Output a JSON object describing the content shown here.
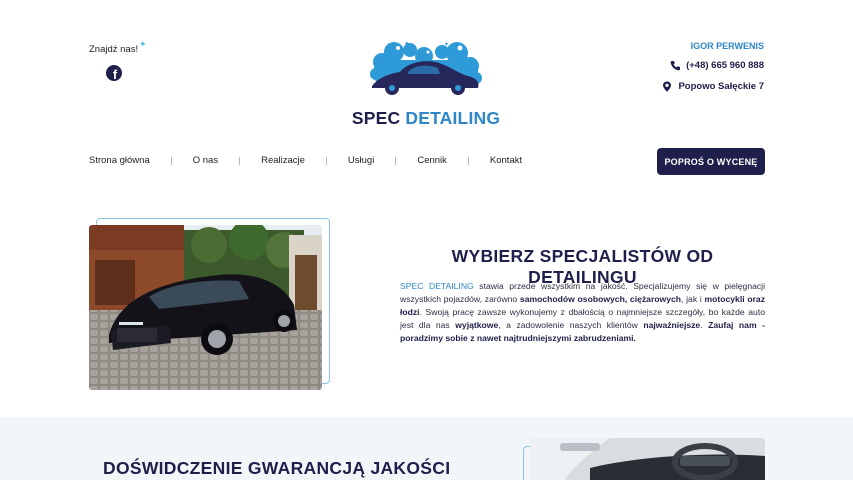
{
  "header": {
    "find_us": "Znajdź nas!",
    "brand_part1": "SPEC",
    "brand_part2": "DETAILING",
    "contact_name": "IGOR PERWENIS",
    "phone": "(+48) 665 960 888",
    "address": "Popowo Sałęckie 7"
  },
  "nav": {
    "items": [
      "Strona główna",
      "O nas",
      "Realizacje",
      "Usługi",
      "Cennik",
      "Kontakt"
    ],
    "cta": "POPROŚ O WYCENĘ"
  },
  "hero": {
    "title": "WYBIERZ SPECJALISTÓW OD DETAILINGU",
    "p_brand1": "SPEC",
    "p_brand2": "DETAILING",
    "p1": " stawia przede wszystkim na jakość. Specjalizujemy się w pielęgnacji wszystkich pojazdów, zarówno ",
    "b1": "samochodów osobowych, ciężarowych",
    "p2": ", jak i ",
    "b2": "motocykli oraz łodzi",
    "p3": ". Swoją pracę zawsze wykonujemy z dbałością o najmniejsze szczegóły, bo każde auto jest dla nas ",
    "b3": "wyjątkowe",
    "p4": ", a zadowolenie naszych klientów ",
    "b4": "najważniejsze",
    "p5": ". ",
    "b5": "Zaufaj nam - poradzimy sobie z nawet najtrudniejszymi zabrudzeniami."
  },
  "section2": {
    "title": "DOŚWIDCZENIE GWARANCJĄ JAKOŚCI"
  },
  "colors": {
    "navy": "#1e1f4b",
    "accent_blue": "#2e86c8",
    "light_blue": "#8ac5e6",
    "section_bg": "#f2f6f9"
  },
  "icons": [
    "facebook-icon",
    "phone-icon",
    "location-pin-icon",
    "car-wash-logo-icon"
  ]
}
